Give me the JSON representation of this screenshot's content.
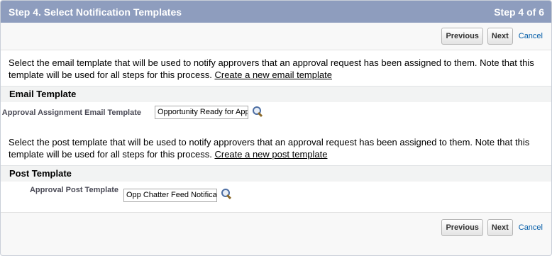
{
  "header": {
    "title": "Step 4. Select Notification Templates",
    "step": "Step 4 of 6"
  },
  "buttons": {
    "previous": "Previous",
    "next": "Next",
    "cancel": "Cancel"
  },
  "email_section": {
    "description": "Select the email template that will be used to notify approvers that an approval request has been assigned to them. Note that this template will be used for all steps for this process.",
    "link": "Create a new email template",
    "heading": "Email Template",
    "field_label": "Approval Assignment Email Template",
    "field_value": "Opportunity Ready for Approval"
  },
  "post_section": {
    "description": "Select the post template that will be used to notify approvers that an approval request has been assigned to them. Note that this template will be used for all steps for this process.",
    "link": "Create a new post template",
    "heading": "Post Template",
    "field_label": "Approval Post Template",
    "field_value": "Opp Chatter Feed Notification"
  },
  "icons": {
    "lookup": "magnifier-lookup-icon"
  }
}
